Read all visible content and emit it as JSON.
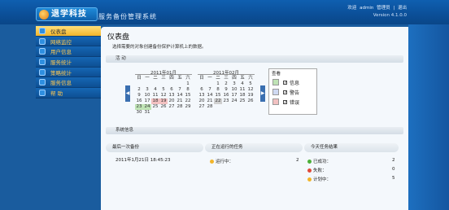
{
  "header": {
    "logo_text": "退学科技",
    "app_title": "服务备份管理系统",
    "links": [
      "欢迎",
      "admin",
      "管理员",
      "|",
      "退出"
    ],
    "version": "Version 4.1.0.0"
  },
  "sidebar": {
    "items": [
      {
        "label": "仪表盘",
        "active": true
      },
      {
        "label": "网络监控",
        "active": false
      },
      {
        "label": "用户信息",
        "active": false
      },
      {
        "label": "服务统计",
        "active": false
      },
      {
        "label": "策略统计",
        "active": false
      },
      {
        "label": "服务信息",
        "active": false
      },
      {
        "label": "帮  助",
        "active": false
      }
    ]
  },
  "main": {
    "title": "仪表盘",
    "description": "选择需要的对象创建备份保护计算机上的数据。",
    "activity_section": "活 动",
    "system_section": "系统信息"
  },
  "calendars": [
    {
      "title": "2011年01月",
      "weekdays": [
        "日",
        "一",
        "二",
        "三",
        "四",
        "五",
        "六"
      ],
      "days": [
        "",
        "",
        "",
        "",
        "",
        "",
        "1",
        "2",
        "3",
        "4",
        "5",
        "6",
        "7",
        "8",
        "9",
        "10",
        "11",
        "12",
        "13",
        "14",
        "15",
        "16",
        "17",
        "18",
        "19",
        "20",
        "21",
        "22",
        "23",
        "24",
        "25",
        "26",
        "27",
        "28",
        "29",
        "30",
        "31"
      ],
      "marks": {
        "18": "fail",
        "19": "fail",
        "23": "ok",
        "24": "ok"
      }
    },
    {
      "title": "2011年02月",
      "weekdays": [
        "日",
        "一",
        "二",
        "三",
        "四",
        "五",
        "六"
      ],
      "days": [
        "",
        "",
        "1",
        "2",
        "3",
        "4",
        "5",
        "6",
        "7",
        "8",
        "9",
        "10",
        "11",
        "12",
        "13",
        "14",
        "15",
        "16",
        "17",
        "18",
        "19",
        "20",
        "21",
        "22",
        "23",
        "24",
        "25",
        "26",
        "27",
        "28"
      ],
      "marks": {
        "22": "today"
      }
    }
  ],
  "legend": {
    "title": "查看",
    "items": [
      {
        "label": "信息",
        "color": "#bfe3b5",
        "checked": true
      },
      {
        "label": "警告",
        "color": "#cfd9f2",
        "checked": true
      },
      {
        "label": "错误",
        "color": "#f2c1c1",
        "checked": true
      }
    ],
    "check_mark": "✓"
  },
  "system_info": {
    "last_backup_header": "最后一次备份",
    "last_backup_value": "2011年1月21日 18:45:23",
    "running_header": "正在运行的任务",
    "running_label": "运行中：",
    "running_count": "2",
    "today_header": "今天任务结果",
    "results": [
      {
        "label": "已成功：",
        "count": "2",
        "color": "#4caf3a"
      },
      {
        "label": "失败：",
        "count": "0",
        "color": "#e04a3a"
      },
      {
        "label": "计划中：",
        "count": "5",
        "color": "#f2b52a"
      }
    ]
  },
  "nav": {
    "prev": "◀",
    "next": "▶"
  }
}
